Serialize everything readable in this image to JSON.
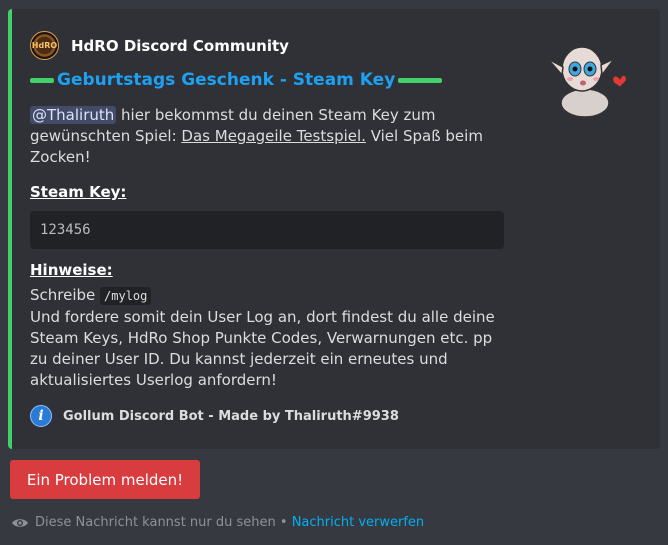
{
  "embed": {
    "accent_color": "#43d06b",
    "author": {
      "name": "HdRO Discord Community",
      "icon": "hdro-logo-icon"
    },
    "title": "Geburtstags Geschenk - Steam Key",
    "description": {
      "mention": "@Thaliruth",
      "text_1": " hier bekommst du deinen Steam Key zum gewünschten Spiel: ",
      "link": "Das Megageile Testspiel.",
      "text_2": " Viel Spaß beim Zocken!"
    },
    "key_field": {
      "name": "Steam Key:",
      "value": "123456"
    },
    "hint_field": {
      "name": "Hinweise:",
      "line_1_prefix": "Schreibe ",
      "command": "/mylog",
      "body": "Und fordere somit dein User Log an, dort findest du alle deine Steam Keys, HdRo Shop Punkte Codes, Verwarnungen etc. pp zu deiner User ID. Du kannst jederzeit ein erneutes und aktualisiertes Userlog anfordern!"
    },
    "thumbnail": "gollum-kiss-sticker",
    "footer": {
      "icon": "info-icon",
      "text": "Gollum Discord Bot - Made by Thaliruth#9938"
    }
  },
  "report_button": {
    "label": "Ein Problem melden!",
    "color": "#d83c3e"
  },
  "ephemeral": {
    "icon": "eye-icon",
    "text": "Diese Nachricht kannst nur du sehen",
    "separator": " • ",
    "dismiss_label": "Nachricht verwerfen"
  }
}
